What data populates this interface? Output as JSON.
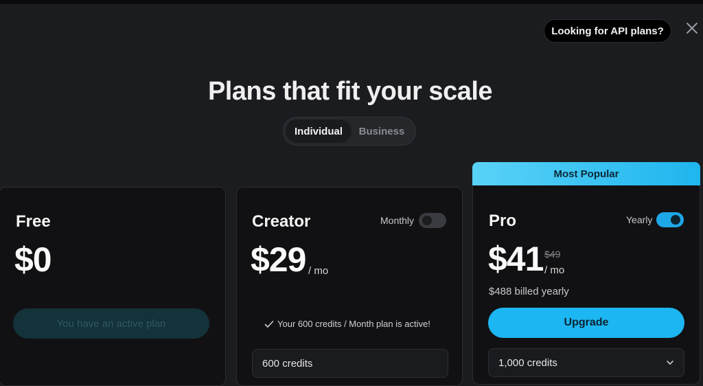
{
  "header": {
    "api_link": "Looking for API plans?",
    "title": "Plans that fit your scale"
  },
  "tabs": [
    {
      "label": "Individual",
      "active": true
    },
    {
      "label": "Business",
      "active": false
    }
  ],
  "plans": {
    "free": {
      "name": "Free",
      "price": "$0",
      "button": "You have an active plan"
    },
    "creator": {
      "name": "Creator",
      "toggle_label": "Monthly",
      "toggle_on": false,
      "price": "$29",
      "per": "/ mo",
      "active_note": "Your 600 credits / Month plan is active!",
      "credits": "600 credits"
    },
    "pro": {
      "badge": "Most Popular",
      "name": "Pro",
      "toggle_label": "Yearly",
      "toggle_on": true,
      "price": "$41",
      "old_price": "$49",
      "per": "/ mo",
      "billing": "$488 billed yearly",
      "button": "Upgrade",
      "credits": "1,000 credits"
    }
  },
  "icons": {
    "close": "close-icon",
    "check": "check-icon",
    "dropdown": "chevron-down-icon"
  },
  "colors": {
    "background": "#1b1c1f",
    "card": "#111113",
    "accent": "#1cb6f2",
    "badge": "#5ad2f7"
  }
}
